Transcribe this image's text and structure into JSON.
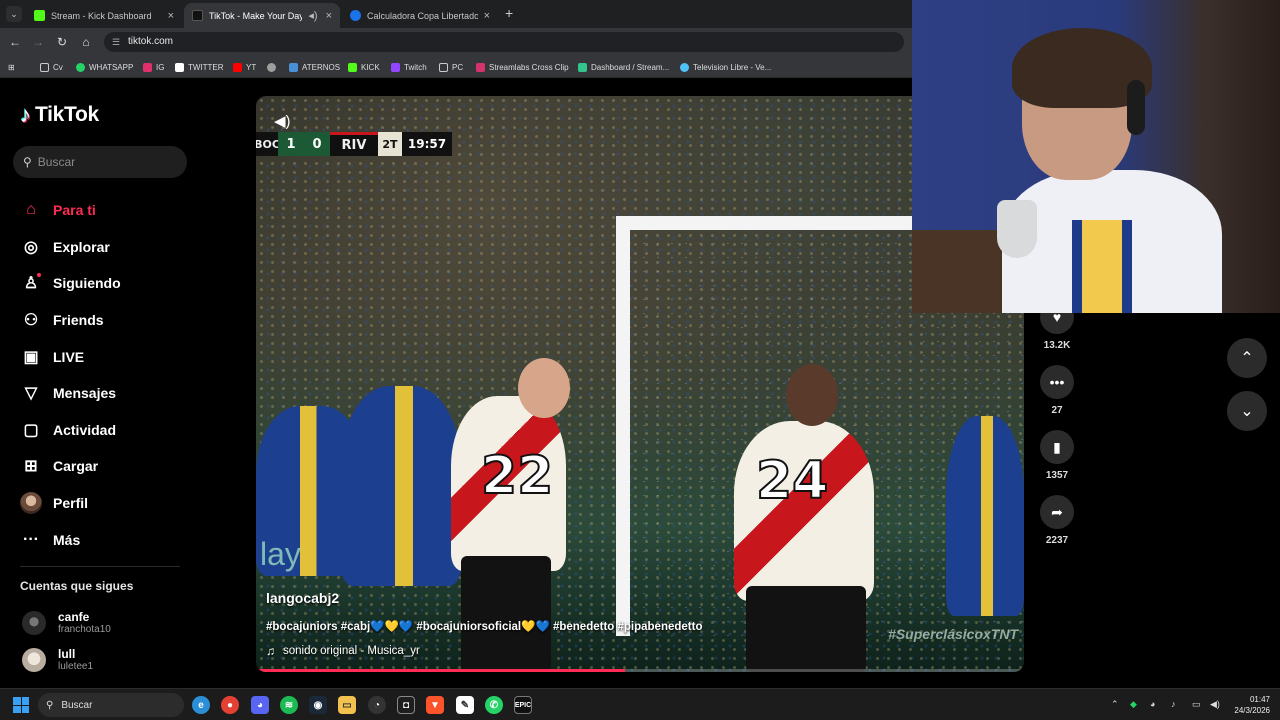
{
  "browser": {
    "tabs": [
      {
        "label": "Stream - Kick Dashboard",
        "active": false,
        "favicon_color": "#53fc18",
        "favicon_text": "K"
      },
      {
        "label": "TikTok - Make Your Day",
        "active": true,
        "favicon_color": "#111111",
        "favicon_text": "♪"
      },
      {
        "label": "Calculadora Copa Libertadores",
        "active": false,
        "favicon_color": "#1a73e8",
        "favicon_text": "@"
      }
    ],
    "url": "tiktok.com",
    "bookmarks": [
      {
        "label": "Cv",
        "color": "#e0e0e0"
      },
      {
        "label": "WHATSAPP",
        "color": "#25d366"
      },
      {
        "label": "IG",
        "color": "#e1306c"
      },
      {
        "label": "TWITTER",
        "color": "#ffffff"
      },
      {
        "label": "YT",
        "color": "#ff0000"
      },
      {
        "label": "",
        "color": "#9e9e9e"
      },
      {
        "label": "ATERNOS",
        "color": "#4a90d9"
      },
      {
        "label": "KICK",
        "color": "#53fc18"
      },
      {
        "label": "Twitch",
        "color": "#9146ff"
      },
      {
        "label": "PC",
        "color": "#e0e0e0"
      },
      {
        "label": "Streamlabs Cross Clip",
        "color": "#d6336c"
      },
      {
        "label": "Dashboard / Stream...",
        "color": "#31c48d"
      },
      {
        "label": "Television Libre - Ve...",
        "color": "#4fc3f7"
      }
    ]
  },
  "tiktok": {
    "logo_text": "TikTok",
    "search_placeholder": "Buscar",
    "nav": [
      {
        "label": "Para ti",
        "icon": "home-icon",
        "glyph": "⌂",
        "active": true
      },
      {
        "label": "Explorar",
        "icon": "compass-icon",
        "glyph": "◎",
        "active": false
      },
      {
        "label": "Siguiendo",
        "icon": "following-icon",
        "glyph": "☺",
        "active": false
      },
      {
        "label": "Friends",
        "icon": "friends-icon",
        "glyph": "⚇",
        "active": false
      },
      {
        "label": "LIVE",
        "icon": "live-icon",
        "glyph": "▣",
        "active": false
      },
      {
        "label": "Mensajes",
        "icon": "messages-icon",
        "glyph": "▽",
        "active": false
      },
      {
        "label": "Actividad",
        "icon": "activity-icon",
        "glyph": "▢",
        "active": false
      },
      {
        "label": "Cargar",
        "icon": "upload-icon",
        "glyph": "⊞",
        "active": false
      },
      {
        "label": "Perfil",
        "icon": "profile-avatar",
        "glyph": "",
        "active": false
      },
      {
        "label": "Más",
        "icon": "more-icon",
        "glyph": "···",
        "active": false
      }
    ],
    "following_title": "Cuentas que sigues",
    "following": [
      {
        "name": "canfe",
        "handle": "franchota10",
        "avatar_color": "#3a3a3a"
      },
      {
        "name": "lull",
        "handle": "luletee1",
        "avatar_color": "#d9d0c7"
      }
    ],
    "video": {
      "username": "langocabj2",
      "hashtags": "#bocajuniors #cabj💙💛💙 #bocajuniorsoficial💛💙 #benedetto #pipabenedetto",
      "sound": "sonido original - Musica_yr",
      "progress": 0.48,
      "scoreboard": {
        "team_home": "BOC",
        "score_home": "1",
        "score_away": "0",
        "team_away": "RIV",
        "half": "2T",
        "clock": "19:57"
      },
      "shirt_numbers": [
        "22",
        "24"
      ],
      "watermark": "#SuperclásicoxTNT"
    },
    "actions": [
      {
        "name": "like",
        "icon": "heart-icon",
        "glyph": "♥",
        "count": "13.2K"
      },
      {
        "name": "comment",
        "icon": "comment-icon",
        "glyph": "•••",
        "count": "27"
      },
      {
        "name": "save",
        "icon": "bookmark-icon",
        "glyph": "▮",
        "count": "1357"
      },
      {
        "name": "share",
        "icon": "share-icon",
        "glyph": "➦",
        "count": "2237"
      }
    ]
  },
  "taskbar": {
    "search_label": "Buscar",
    "time": "01:47",
    "date": "24/3/2026"
  }
}
